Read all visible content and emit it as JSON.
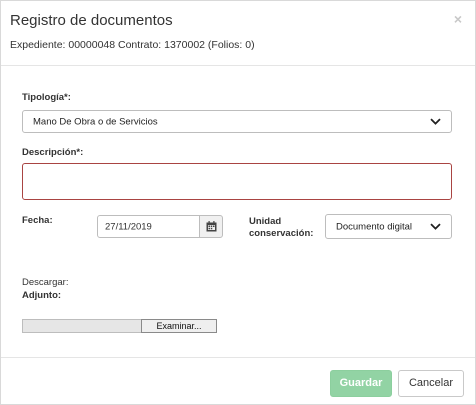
{
  "dialog": {
    "title": "Registro de documentos",
    "subtitle": "Expediente: 00000048 Contrato: 1370002 (Folios: 0)",
    "close_symbol": "×"
  },
  "form": {
    "tipologia": {
      "label": "Tipología*:",
      "value": "Mano De Obra o de Servicios"
    },
    "descripcion": {
      "label": "Descripción*:",
      "value": ""
    },
    "fecha": {
      "label": "Fecha:",
      "value": "27/11/2019",
      "icon": "calendar-icon"
    },
    "unidad": {
      "label_line1": "Unidad",
      "label_line2": "conservación:",
      "value": "Documento digital"
    },
    "descargar_label": "Descargar:",
    "adjunto": {
      "label": "Adjunto:",
      "button_label": "Examinar..."
    }
  },
  "footer": {
    "save_label": "Guardar",
    "cancel_label": "Cancelar"
  },
  "colors": {
    "save_bg": "#92d3a4",
    "error_border": "#a94442"
  }
}
